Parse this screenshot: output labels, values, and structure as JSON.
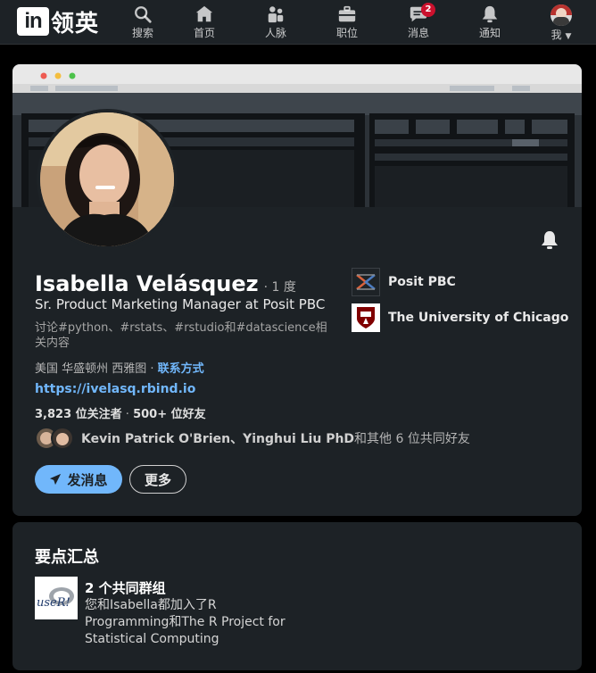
{
  "nav": {
    "logo_mark": "in",
    "logo_text": "领英",
    "items": [
      {
        "label": "搜索",
        "icon": "search-icon"
      },
      {
        "label": "首页",
        "icon": "home-icon"
      },
      {
        "label": "人脉",
        "icon": "people-icon"
      },
      {
        "label": "职位",
        "icon": "briefcase-icon"
      },
      {
        "label": "消息",
        "icon": "messaging-icon",
        "badge": "2"
      },
      {
        "label": "通知",
        "icon": "bell-icon"
      },
      {
        "label": "我",
        "icon": "avatar"
      }
    ]
  },
  "profile": {
    "name": "Isabella Velásquez",
    "degree": "· 1 度",
    "headline": "Sr. Product Marketing Manager at Posit PBC",
    "topics": "讨论#python、#rstats、#rstudio和#datascience相关内容",
    "location": "美国 华盛顿州 西雅图 · ",
    "contact_label": "联系方式",
    "website": "https://ivelasq.rbind.io",
    "followers": "3,823 位关注者",
    "connections": "500+ 位好友",
    "followers_sep": " · ",
    "mutual_names": "Kevin Patrick O'Brien、Yinghui Liu PhD",
    "mutual_suffix": "和其他 6 位共同好友",
    "message_button": "发消息",
    "more_button": "更多",
    "orgs": [
      {
        "name": "Posit PBC"
      },
      {
        "name": "The University of Chicago"
      }
    ]
  },
  "highlights": {
    "title": "要点汇总",
    "group_title": "2 个共同群组",
    "group_desc": "您和Isabella都加入了R Programming和The R Project for Statistical Computing",
    "logo_text": "useR!"
  },
  "colors": {
    "background": "#000000",
    "card": "#1d2226",
    "link": "#71b7fb",
    "badge": "#cb112d"
  }
}
